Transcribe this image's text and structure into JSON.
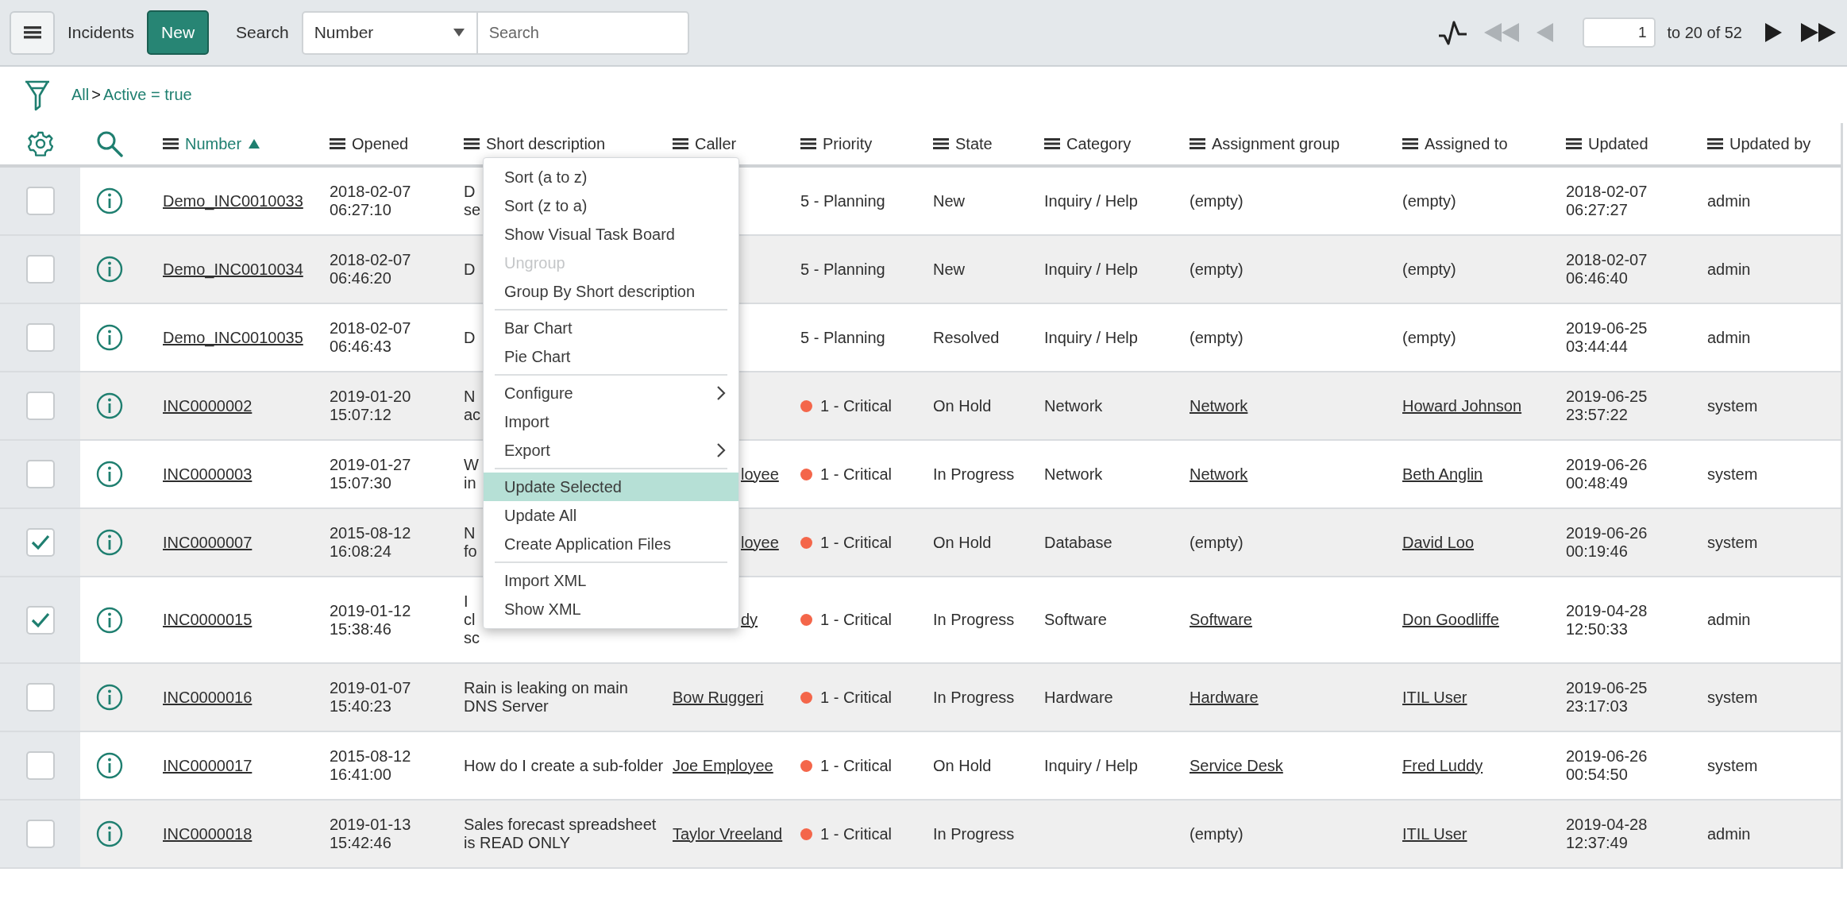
{
  "toolbar": {
    "title": "Incidents",
    "new_button": "New",
    "search_label": "Search",
    "search_field": {
      "value": "Number"
    },
    "search_input": {
      "placeholder": "Search"
    },
    "page_input": "1",
    "range": "to 20 of 52",
    "nav": [
      {
        "kind": "first",
        "disabled": true
      },
      {
        "kind": "prev",
        "disabled": true
      },
      {
        "kind": "next",
        "disabled": false
      },
      {
        "kind": "last",
        "disabled": false
      }
    ]
  },
  "breadcrumb": {
    "items": [
      "All",
      "Active = true"
    ],
    "separator": ">"
  },
  "columns": [
    {
      "kind": "settings"
    },
    {
      "kind": "search"
    },
    {
      "kind": "field",
      "label": "Number",
      "sorted": true
    },
    {
      "kind": "field",
      "label": "Opened",
      "sorted": false
    },
    {
      "kind": "field",
      "label": "Short description",
      "sorted": false
    },
    {
      "kind": "field",
      "label": "Caller",
      "sorted": false
    },
    {
      "kind": "field",
      "label": "Priority",
      "sorted": false
    },
    {
      "kind": "field",
      "label": "State",
      "sorted": false
    },
    {
      "kind": "field",
      "label": "Category",
      "sorted": false
    },
    {
      "kind": "field",
      "label": "Assignment group",
      "sorted": false
    },
    {
      "kind": "field",
      "label": "Assigned to",
      "sorted": false
    },
    {
      "kind": "field",
      "label": "Updated",
      "sorted": false
    },
    {
      "kind": "field",
      "label": "Updated by",
      "sorted": false
    }
  ],
  "rows": [
    {
      "selected": false,
      "number": "Demo_INC0010033",
      "opened": "2018-02-07 06:27:10",
      "short_description": "D\nse",
      "priority": {
        "text": "5 - Planning"
      },
      "state": "New",
      "category": "Inquiry / Help",
      "assignment_group": {
        "text": "(empty)",
        "link": false
      },
      "assigned_to": {
        "text": "(empty)",
        "link": false
      },
      "updated": "2018-02-07 06:27:27",
      "updated_by": "admin"
    },
    {
      "selected": false,
      "number": "Demo_INC0010034",
      "opened": "2018-02-07 06:46:20",
      "short_description": "D",
      "priority": {
        "text": "5 - Planning"
      },
      "state": "New",
      "category": "Inquiry / Help",
      "assignment_group": {
        "text": "(empty)",
        "link": false
      },
      "assigned_to": {
        "text": "(empty)",
        "link": false
      },
      "updated": "2018-02-07 06:46:40",
      "updated_by": "admin"
    },
    {
      "selected": false,
      "number": "Demo_INC0010035",
      "opened": "2018-02-07 06:46:43",
      "short_description": "D",
      "priority": {
        "text": "5 - Planning"
      },
      "state": "Resolved",
      "category": "Inquiry / Help",
      "assignment_group": {
        "text": "(empty)",
        "link": false
      },
      "assigned_to": {
        "text": "(empty)",
        "link": false
      },
      "updated": "2019-06-25 03:44:44",
      "updated_by": "admin"
    },
    {
      "selected": false,
      "number": "INC0000002",
      "opened": "2019-01-20 15:07:12",
      "short_description": "N\nac",
      "priority": {
        "text": "1 - Critical",
        "color": "#f4664a"
      },
      "state": "On Hold",
      "category": "Network",
      "assignment_group": {
        "text": "Network",
        "link": true
      },
      "assigned_to": {
        "text": "Howard Johnson",
        "link": true
      },
      "updated": "2019-06-25 23:57:22",
      "updated_by": "system"
    },
    {
      "selected": false,
      "number": "INC0000003",
      "opened": "2019-01-27 15:07:30",
      "short_description": "W\nin",
      "caller": {
        "text": "loyee",
        "link": true,
        "cut_left": true
      },
      "priority": {
        "text": "1 - Critical",
        "color": "#f4664a"
      },
      "state": "In Progress",
      "category": "Network",
      "assignment_group": {
        "text": "Network",
        "link": true
      },
      "assigned_to": {
        "text": "Beth Anglin",
        "link": true
      },
      "updated": "2019-06-26 00:48:49",
      "updated_by": "system"
    },
    {
      "selected": true,
      "number": "INC0000007",
      "opened": "2015-08-12 16:08:24",
      "short_description": "N\nfo",
      "caller": {
        "text": "loyee",
        "link": true,
        "cut_left": true
      },
      "priority": {
        "text": "1 - Critical",
        "color": "#f4664a"
      },
      "state": "On Hold",
      "category": "Database",
      "assignment_group": {
        "text": "(empty)",
        "link": false
      },
      "assigned_to": {
        "text": "David Loo",
        "link": true
      },
      "updated": "2019-06-26 00:19:46",
      "updated_by": "system"
    },
    {
      "selected": true,
      "number": "INC0000015",
      "opened": "2019-01-12 15:38:46",
      "short_description": "I\ncl\nsc",
      "caller": {
        "text": "dy",
        "link": true,
        "cut_left": true
      },
      "priority": {
        "text": "1 - Critical",
        "color": "#f4664a"
      },
      "state": "In Progress",
      "category": "Software",
      "assignment_group": {
        "text": "Software",
        "link": true
      },
      "assigned_to": {
        "text": "Don Goodliffe",
        "link": true
      },
      "updated": "2019-04-28 12:50:33",
      "updated_by": "admin"
    },
    {
      "selected": false,
      "number": "INC0000016",
      "opened": "2019-01-07 15:40:23",
      "short_description": "Rain is leaking on main DNS Server",
      "caller": {
        "text": "Bow Ruggeri",
        "link": true
      },
      "priority": {
        "text": "1 - Critical",
        "color": "#f4664a"
      },
      "state": "In Progress",
      "category": "Hardware",
      "assignment_group": {
        "text": "Hardware",
        "link": true
      },
      "assigned_to": {
        "text": "ITIL User",
        "link": true
      },
      "updated": "2019-06-25 23:17:03",
      "updated_by": "system"
    },
    {
      "selected": false,
      "number": "INC0000017",
      "opened": "2015-08-12 16:41:00",
      "short_description": "How do I create a sub-folder",
      "caller": {
        "text": "Joe Employee",
        "link": true
      },
      "priority": {
        "text": "1 - Critical",
        "color": "#f4664a"
      },
      "state": "On Hold",
      "category": "Inquiry / Help",
      "assignment_group": {
        "text": "Service Desk",
        "link": true
      },
      "assigned_to": {
        "text": "Fred Luddy",
        "link": true
      },
      "updated": "2019-06-26 00:54:50",
      "updated_by": "system"
    },
    {
      "selected": false,
      "number": "INC0000018",
      "opened": "2019-01-13 15:42:46",
      "short_description": "Sales forecast spreadsheet is READ ONLY",
      "caller": {
        "text": "Taylor Vreeland",
        "link": true
      },
      "priority": {
        "text": "1 - Critical",
        "color": "#f4664a"
      },
      "state": "In Progress",
      "assignment_group": {
        "text": "(empty)",
        "link": false
      },
      "assigned_to": {
        "text": "ITIL User",
        "link": true
      },
      "updated": "2019-04-28 12:37:49",
      "updated_by": "admin"
    }
  ],
  "context_menu": [
    {
      "kind": "item",
      "label": "Sort (a to z)",
      "disabled": false,
      "selected": false,
      "submenu": false
    },
    {
      "kind": "item",
      "label": "Sort (z to a)",
      "disabled": false,
      "selected": false,
      "submenu": false
    },
    {
      "kind": "item",
      "label": "Show Visual Task Board",
      "disabled": false,
      "selected": false,
      "submenu": false
    },
    {
      "kind": "item",
      "label": "Ungroup",
      "disabled": true,
      "selected": false,
      "submenu": false
    },
    {
      "kind": "item",
      "label": "Group By Short description",
      "disabled": false,
      "selected": false,
      "submenu": false
    },
    {
      "kind": "separator"
    },
    {
      "kind": "item",
      "label": "Bar Chart",
      "disabled": false,
      "selected": false,
      "submenu": false
    },
    {
      "kind": "item",
      "label": "Pie Chart",
      "disabled": false,
      "selected": false,
      "submenu": false
    },
    {
      "kind": "separator"
    },
    {
      "kind": "item",
      "label": "Configure",
      "disabled": false,
      "selected": false,
      "submenu": true
    },
    {
      "kind": "item",
      "label": "Import",
      "disabled": false,
      "selected": false,
      "submenu": false
    },
    {
      "kind": "item",
      "label": "Export",
      "disabled": false,
      "selected": false,
      "submenu": true
    },
    {
      "kind": "separator"
    },
    {
      "kind": "item",
      "label": "Update Selected",
      "disabled": false,
      "selected": true,
      "submenu": false
    },
    {
      "kind": "item",
      "label": "Update All",
      "disabled": false,
      "selected": false,
      "submenu": false
    },
    {
      "kind": "item",
      "label": "Create Application Files",
      "disabled": false,
      "selected": false,
      "submenu": false
    },
    {
      "kind": "separator"
    },
    {
      "kind": "item",
      "label": "Import XML",
      "disabled": false,
      "selected": false,
      "submenu": false
    },
    {
      "kind": "item",
      "label": "Show XML",
      "disabled": false,
      "selected": false,
      "submenu": false
    }
  ]
}
